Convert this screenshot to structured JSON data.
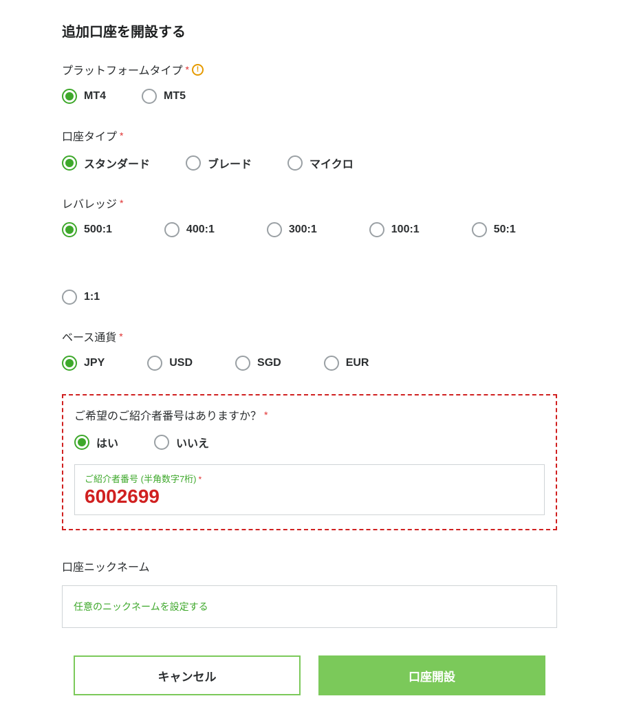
{
  "title": "追加口座を開設する",
  "platform": {
    "label": "プラットフォームタイプ",
    "required": "*",
    "opts": [
      "MT4",
      "MT5"
    ]
  },
  "account_type": {
    "label": "口座タイプ",
    "required": "*",
    "opts": [
      "スタンダード",
      "ブレード",
      "マイクロ"
    ]
  },
  "leverage": {
    "label": "レバレッジ",
    "required": "*",
    "opts": [
      "500:1",
      "400:1",
      "300:1",
      "100:1",
      "50:1",
      "1:1"
    ]
  },
  "currency": {
    "label": "ベース通貨",
    "required": "*",
    "opts": [
      "JPY",
      "USD",
      "SGD",
      "EUR"
    ]
  },
  "referrer": {
    "label": "ご希望のご紹介者番号はありますか？",
    "required": "*",
    "opts": [
      "はい",
      "いいえ"
    ],
    "field_label": "ご紹介者番号 (半角数字7桁)",
    "field_required": "*",
    "value": "6002699"
  },
  "nickname": {
    "label": "口座ニックネーム",
    "placeholder": "任意のニックネームを設定する"
  },
  "buttons": {
    "cancel": "キャンセル",
    "submit": "口座開設"
  }
}
